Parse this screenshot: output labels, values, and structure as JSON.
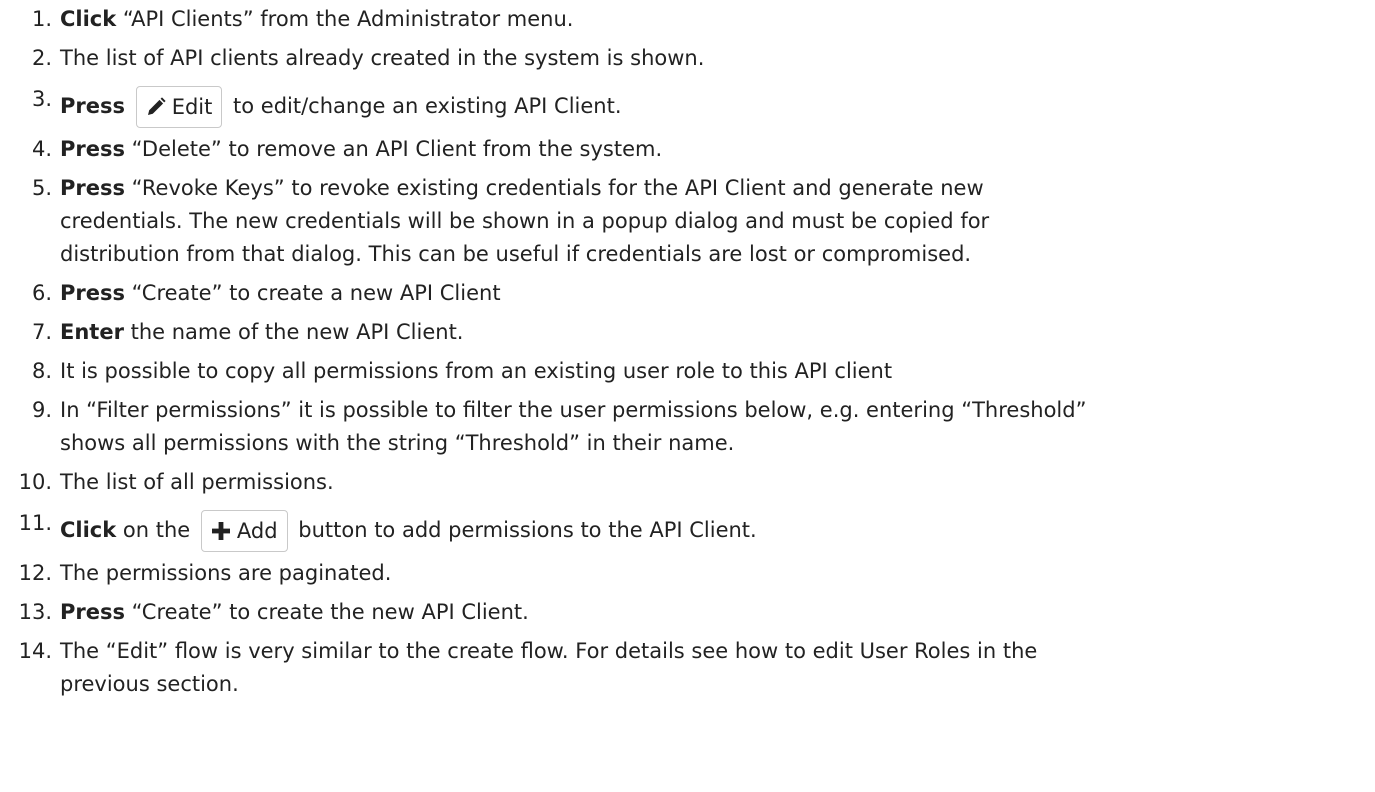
{
  "steps": [
    {
      "num": "1.",
      "bold": "Click",
      "rest": " “API Clients” from the Administrator menu."
    },
    {
      "num": "2.",
      "bold": "",
      "rest": "The list of API clients already created in the system is shown."
    },
    {
      "num": "3.",
      "bold": "Press",
      "button_label": "Edit",
      "button_icon": "pencil-icon",
      "after": " to edit/change an existing API Client."
    },
    {
      "num": "4.",
      "bold": "Press",
      "rest": " “Delete” to remove an API Client from the system."
    },
    {
      "num": "5.",
      "bold": "Press",
      "rest": " “Revoke Keys” to revoke existing credentials for the API Client and generate new",
      "lines": [
        "credentials. The new credentials will be shown in a popup dialog and must be copied for",
        "distribution from that dialog. This can be useful if credentials are lost or compromised."
      ]
    },
    {
      "num": "6.",
      "bold": "Press",
      "rest": " “Create” to create a new API Client"
    },
    {
      "num": "7.",
      "bold": "Enter",
      "rest": " the name of the new API Client."
    },
    {
      "num": "8.",
      "bold": "",
      "rest": "It is possible to copy all permissions from an existing user role to this API client"
    },
    {
      "num": "9.",
      "bold": "",
      "rest": "In “Filter permissions” it is possible to filter the user permissions below, e.g. entering “Threshold”",
      "lines": [
        "shows all permissions with the string “Threshold” in their name."
      ]
    },
    {
      "num": "10.",
      "bold": "",
      "rest": "The list of all permissions."
    },
    {
      "num": "11.",
      "bold": "Click",
      "pre": " on the",
      "button_label": "Add",
      "button_icon": "plus-icon",
      "after": " button to add permissions to the API Client."
    },
    {
      "num": "12.",
      "bold": "",
      "rest": "The permissions are paginated."
    },
    {
      "num": "13.",
      "bold": "Press",
      "rest": " “Create” to create the new API Client."
    },
    {
      "num": "14.",
      "bold": "",
      "rest": "The “Edit” flow is very similar to the create flow. For details see how to edit User Roles in the",
      "lines": [
        "previous section."
      ]
    }
  ]
}
